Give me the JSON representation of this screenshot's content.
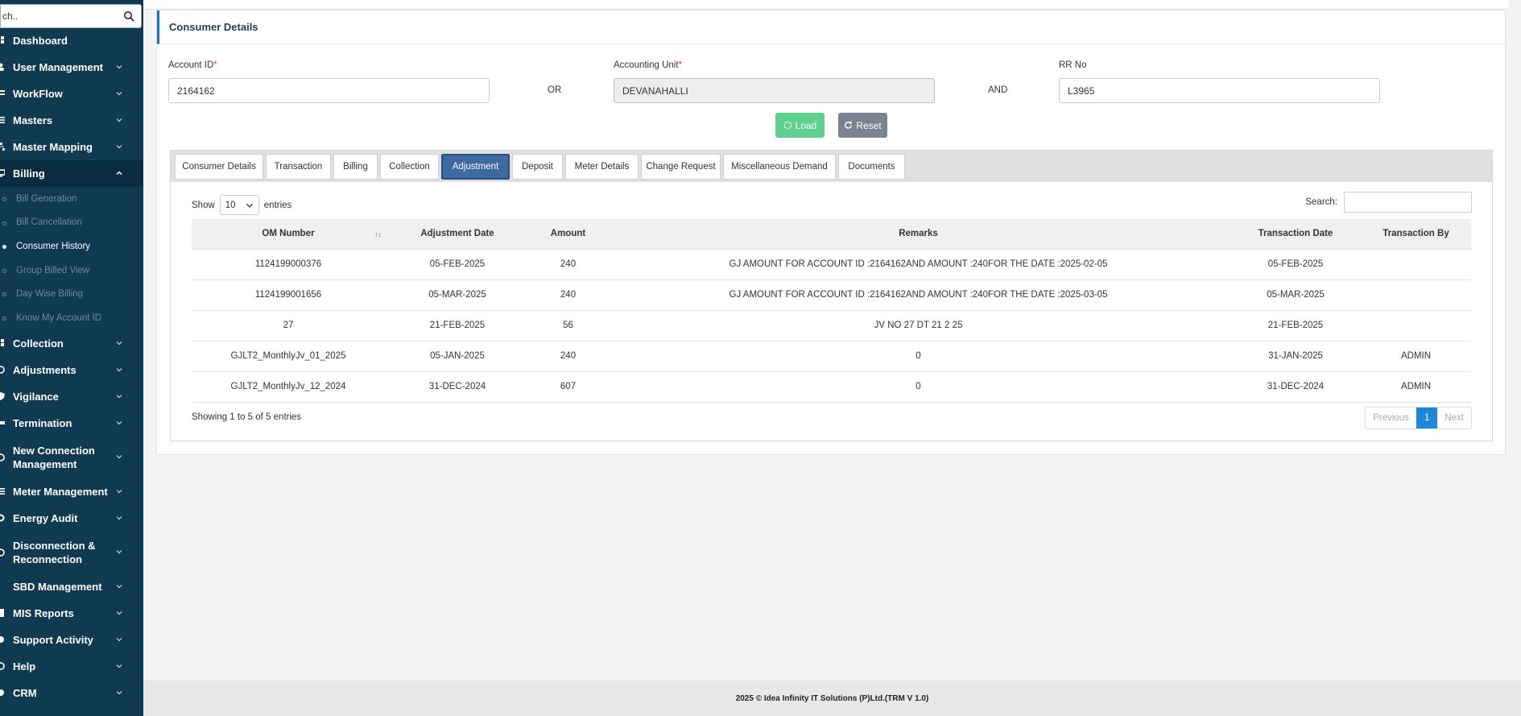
{
  "sidebar": {
    "search_value": "ch..",
    "items": [
      {
        "label": "Dashboard"
      },
      {
        "label": "User Management"
      },
      {
        "label": "WorkFlow"
      },
      {
        "label": "Masters"
      },
      {
        "label": "Master Mapping"
      },
      {
        "label": "Billing"
      },
      {
        "label": "Collection"
      },
      {
        "label": "Adjustments"
      },
      {
        "label": "Vigilance"
      },
      {
        "label": "Termination"
      },
      {
        "label": "New Connection Management"
      },
      {
        "label": "Meter Management"
      },
      {
        "label": "Energy Audit"
      },
      {
        "label": "Disconnection & Reconnection"
      },
      {
        "label": "SBD Management"
      },
      {
        "label": "MIS Reports"
      },
      {
        "label": "Support Activity"
      },
      {
        "label": "Help"
      },
      {
        "label": "CRM"
      }
    ],
    "billing_sub": [
      {
        "label": "Bill Generation"
      },
      {
        "label": "Bill Cancellation"
      },
      {
        "label": "Consumer History"
      },
      {
        "label": "Group Billed View"
      },
      {
        "label": "Day Wise Billing"
      },
      {
        "label": "Know My Account ID"
      }
    ]
  },
  "card": {
    "title": "Consumer Details"
  },
  "form": {
    "account_id_label": "Account ID",
    "account_id_value": "2164162",
    "or_label": "OR",
    "accounting_unit_label": "Accounting Unit",
    "accounting_unit_value": "DEVANAHALLI",
    "and_label": "AND",
    "rr_no_label": "RR No",
    "rr_no_value": "L3965",
    "required_mark": "*",
    "load_label": "Load",
    "reset_label": "Reset"
  },
  "tabs": [
    {
      "label": "Consumer Details"
    },
    {
      "label": "Transaction"
    },
    {
      "label": "Billing"
    },
    {
      "label": "Collection"
    },
    {
      "label": "Adjustment"
    },
    {
      "label": "Deposit"
    },
    {
      "label": "Meter Details"
    },
    {
      "label": "Change Request"
    },
    {
      "label": "Miscellaneous Demand"
    },
    {
      "label": "Documents"
    }
  ],
  "table_controls": {
    "show_label": "Show",
    "page_size": "10",
    "entries_label": "entries",
    "search_label": "Search:"
  },
  "table": {
    "headers": [
      "OM Number",
      "Adjustment Date",
      "Amount",
      "Remarks",
      "Transaction Date",
      "Transaction By"
    ],
    "sort_indicator": "↑↓",
    "rows": [
      [
        "1124199000376",
        "05-FEB-2025",
        "240",
        "GJ AMOUNT FOR ACCOUNT ID :2164162AND AMOUNT :240FOR THE DATE :2025-02-05",
        "05-FEB-2025",
        ""
      ],
      [
        "1124199001656",
        "05-MAR-2025",
        "240",
        "GJ AMOUNT FOR ACCOUNT ID :2164162AND AMOUNT :240FOR THE DATE :2025-03-05",
        "05-MAR-2025",
        ""
      ],
      [
        "27",
        "21-FEB-2025",
        "56",
        "JV NO 27 DT 21 2 25",
        "21-FEB-2025",
        ""
      ],
      [
        "GJLT2_MonthlyJv_01_2025",
        "05-JAN-2025",
        "240",
        "0",
        "31-JAN-2025",
        "ADMIN"
      ],
      [
        "GJLT2_MonthlyJv_12_2024",
        "31-DEC-2024",
        "607",
        "0",
        "31-DEC-2024",
        "ADMIN"
      ]
    ]
  },
  "pagination": {
    "info": "Showing 1 to 5 of 5 entries",
    "previous": "Previous",
    "current": "1",
    "next": "Next"
  },
  "footer": {
    "text": "2025 © Idea Infinity IT Solutions (P)Ltd.(TRM V 1.0)"
  },
  "colors": {
    "sidebar_bg": "#0f3a52",
    "active_tab": "#3d6aa1",
    "load_button": "#5fd08e",
    "reset_button": "#7a8390",
    "page_active": "#1e88d8"
  }
}
